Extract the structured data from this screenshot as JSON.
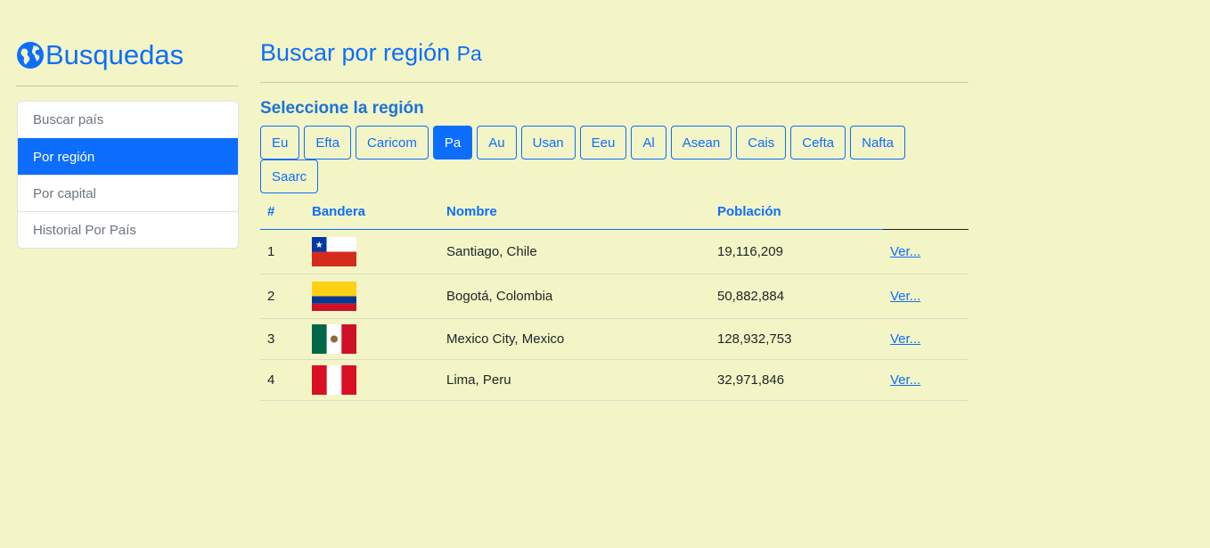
{
  "sidebar": {
    "title": "Busquedas",
    "items": [
      {
        "label": "Buscar país"
      },
      {
        "label": "Por región"
      },
      {
        "label": "Por capital"
      },
      {
        "label": "Historial Por País"
      }
    ]
  },
  "main": {
    "title": "Buscar por región",
    "region": "Pa",
    "subtitle": "Seleccione la región",
    "regions": [
      "Eu",
      "Efta",
      "Caricom",
      "Pa",
      "Au",
      "Usan",
      "Eeu",
      "Al",
      "Asean",
      "Cais",
      "Cefta",
      "Nafta",
      "Saarc"
    ],
    "table": {
      "headers": [
        "#",
        "Bandera",
        "Nombre",
        "Población",
        ""
      ],
      "rows": [
        {
          "n": "1",
          "flag": "chile-flag",
          "name": "Santiago, Chile",
          "population": "19,116,209",
          "link": "Ver..."
        },
        {
          "n": "2",
          "flag": "colombia-flag",
          "name": "Bogotá, Colombia",
          "population": "50,882,884",
          "link": "Ver..."
        },
        {
          "n": "3",
          "flag": "mexico-flag",
          "name": "Mexico City, Mexico",
          "population": "128,932,753",
          "link": "Ver..."
        },
        {
          "n": "4",
          "flag": "peru-flag",
          "name": "Lima, Peru",
          "population": "32,971,846",
          "link": "Ver..."
        }
      ]
    }
  },
  "colors": {
    "accent": "#0d6efd",
    "background": "#f3f5c6"
  }
}
